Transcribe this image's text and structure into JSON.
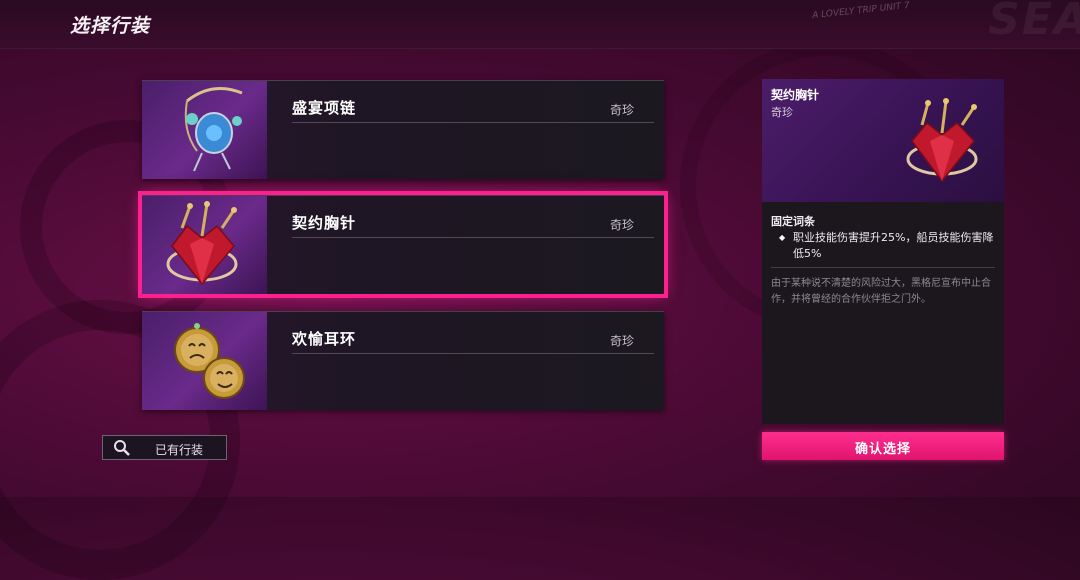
{
  "header": {
    "title": "选择行装",
    "deco_small": "A LOVELY TRIP UNIT 7",
    "deco_big": "SEA"
  },
  "items": [
    {
      "name": "盛宴项链",
      "rarity": "奇珍",
      "icon": "necklace-icon",
      "selected": false
    },
    {
      "name": "契约胸针",
      "rarity": "奇珍",
      "icon": "brooch-icon",
      "selected": true
    },
    {
      "name": "欢愉耳环",
      "rarity": "奇珍",
      "icon": "earring-icon",
      "selected": false
    }
  ],
  "owned_button": {
    "label": "已有行装",
    "icon": "magnifier-icon"
  },
  "detail": {
    "name": "契约胸针",
    "rarity": "奇珍",
    "section_title": "固定词条",
    "effect_bullet": "◆",
    "effect": "职业技能伤害提升25%，船员技能伤害降低5%",
    "flavor": "由于某种说不清楚的风险过大，黑格尼宣布中止合作，并将曾经的合作伙伴拒之门外。"
  },
  "confirm_button": {
    "label": "确认选择"
  },
  "colors": {
    "accent": "#ff1f8e",
    "card_bg": "#1e1624",
    "thumb_bg": "#5a2480"
  }
}
